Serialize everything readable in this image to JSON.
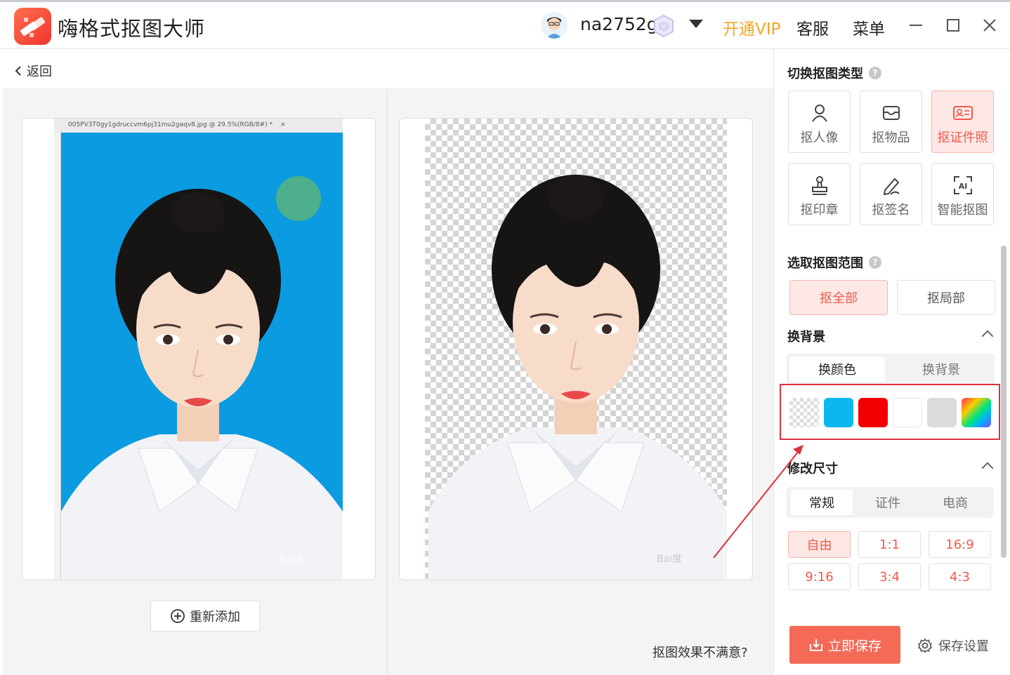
{
  "titlebar": {
    "app_title": "嗨格式抠图大师",
    "username": "na2752g",
    "vip_link": "开通VIP",
    "service_link": "客服",
    "menu_link": "菜单",
    "icons": [
      "app-logo-icon",
      "avatar",
      "vip-badge-icon",
      "caret-down-icon",
      "minimize-icon",
      "maximize-icon",
      "close-icon"
    ]
  },
  "backbar": {
    "back_label": "返回"
  },
  "workarea": {
    "original_filename": "005PV3T0gy1gdruccvm6pj31mu2gaqv8.jpg @ 29.5%(RGB/8#) *",
    "original_tab_close": "×",
    "readd_label": "重新添加",
    "unsatisfied_label": "抠图效果不满意?",
    "original_bg_color": "#0b9be0"
  },
  "panel": {
    "switch_type_title": "切换抠图类型",
    "types": [
      {
        "label": "抠人像",
        "icon": "person-icon",
        "active": false
      },
      {
        "label": "抠物品",
        "icon": "box-icon",
        "active": false
      },
      {
        "label": "抠证件照",
        "icon": "id-card-icon",
        "active": true
      },
      {
        "label": "抠印章",
        "icon": "stamp-icon",
        "active": false
      },
      {
        "label": "抠签名",
        "icon": "pen-icon",
        "active": false
      },
      {
        "label": "智能抠图",
        "icon": "ai-icon",
        "active": false
      }
    ],
    "range_title": "选取抠图范围",
    "range_all": "抠全部",
    "range_part": "抠局部",
    "background_title": "换背景",
    "bg_tab_color": "换颜色",
    "bg_tab_image": "换背景",
    "swatches": [
      {
        "name": "transparent",
        "color": "transparent"
      },
      {
        "name": "blue",
        "color": "#0bb8ee"
      },
      {
        "name": "red",
        "color": "#f20000"
      },
      {
        "name": "white",
        "color": "#ffffff"
      },
      {
        "name": "gray",
        "color": "#dcdcdc"
      },
      {
        "name": "rainbow",
        "color": "gradient"
      }
    ],
    "resize_title": "修改尺寸",
    "size_tabs": [
      "常规",
      "证件",
      "电商"
    ],
    "ratios": [
      "自由",
      "1:1",
      "16:9",
      "9:16",
      "3:4",
      "4:3"
    ],
    "save_button": "立即保存",
    "save_settings": "保存设置",
    "accent_color": "#f46a57",
    "highlight_color": "#e0303a"
  }
}
